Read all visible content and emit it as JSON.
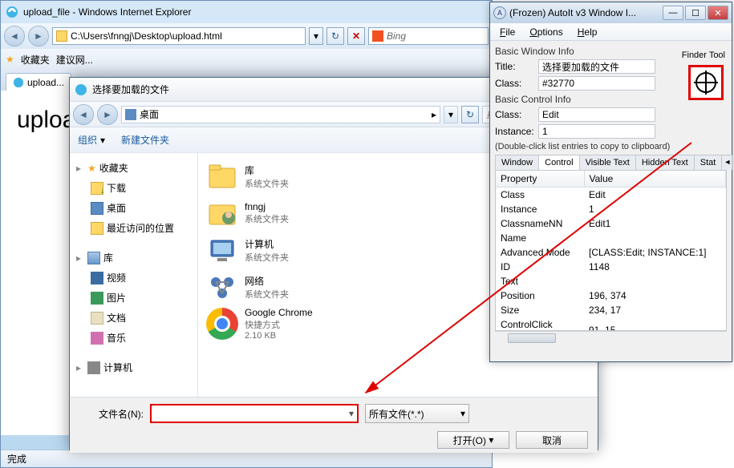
{
  "ie": {
    "title": "upload_file - Windows Internet Explorer",
    "address": "C:\\Users\\fnngj\\Desktop\\upload.html",
    "search_placeholder": "Bing",
    "fav_label": "收藏夹",
    "fav_item": "建议网...",
    "tab_label": "upload...",
    "page_h1": "uploa",
    "status": "完成"
  },
  "dlg": {
    "title": "选择要加载的文件",
    "location": "桌面",
    "search_placeholder": "搜索 桌",
    "org": "组织",
    "newfolder": "新建文件夹",
    "tree": {
      "fav": "收藏夹",
      "dl": "下载",
      "desk": "桌面",
      "recent": "最近访问的位置",
      "lib": "库",
      "vid": "视频",
      "pic": "图片",
      "doc": "文档",
      "mus": "音乐",
      "comp": "计算机"
    },
    "files": [
      {
        "name": "库",
        "sub": "系统文件夹",
        "icon": "lib"
      },
      {
        "name": "fnngj",
        "sub": "系统文件夹",
        "icon": "user"
      },
      {
        "name": "计算机",
        "sub": "系统文件夹",
        "icon": "comp"
      },
      {
        "name": "网络",
        "sub": "系统文件夹",
        "icon": "net"
      },
      {
        "name": "Google Chrome",
        "sub": "快捷方式",
        "sub2": "2.10 KB",
        "icon": "chrome"
      }
    ],
    "filename_label": "文件名(N):",
    "filter": "所有文件(*.*)",
    "open": "打开(O)",
    "cancel": "取消"
  },
  "au3": {
    "title": "(Frozen) AutoIt v3 Window I...",
    "menu": {
      "file": "File",
      "options": "Options",
      "help": "Help"
    },
    "basic_window": "Basic Window Info",
    "title_label": "Title:",
    "title_val": "选择要加载的文件",
    "class_label": "Class:",
    "class_val": "#32770",
    "basic_control": "Basic Control Info",
    "ctrl_class_label": "Class:",
    "ctrl_class_val": "Edit",
    "inst_label": "Instance:",
    "inst_val": "1",
    "finder_label": "Finder Tool",
    "hint": "(Double-click list entries to copy to clipboard)",
    "tabs": [
      "Window",
      "Control",
      "Visible Text",
      "Hidden Text",
      "Stat"
    ],
    "prop_header": "Property",
    "val_header": "Value",
    "props": [
      [
        "Class",
        "Edit"
      ],
      [
        "Instance",
        "1"
      ],
      [
        "ClassnameNN",
        "Edit1"
      ],
      [
        "Name",
        ""
      ],
      [
        "Advanced Mode",
        "[CLASS:Edit; INSTANCE:1]"
      ],
      [
        "ID",
        "1148"
      ],
      [
        "Text",
        ""
      ],
      [
        "Position",
        "196, 374"
      ],
      [
        "Size",
        "234, 17"
      ],
      [
        "ControlClick Coords",
        "91, 15"
      ]
    ]
  }
}
